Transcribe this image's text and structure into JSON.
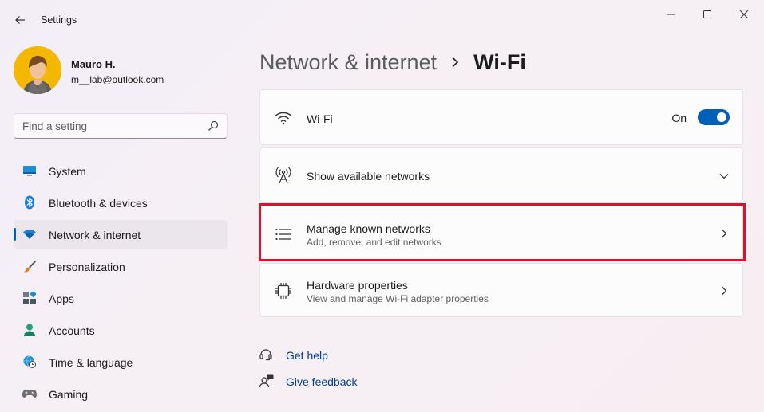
{
  "app": {
    "title": "Settings"
  },
  "user": {
    "name": "Mauro H.",
    "email": "m__lab@outlook.com"
  },
  "search": {
    "placeholder": "Find a setting",
    "value": ""
  },
  "sidebar": {
    "items": [
      {
        "label": "System",
        "icon": "system-icon"
      },
      {
        "label": "Bluetooth & devices",
        "icon": "bluetooth-icon"
      },
      {
        "label": "Network & internet",
        "icon": "wifi-icon",
        "active": true
      },
      {
        "label": "Personalization",
        "icon": "brush-icon"
      },
      {
        "label": "Apps",
        "icon": "apps-icon"
      },
      {
        "label": "Accounts",
        "icon": "person-icon"
      },
      {
        "label": "Time & language",
        "icon": "globe-clock-icon"
      },
      {
        "label": "Gaming",
        "icon": "gamepad-icon"
      }
    ]
  },
  "breadcrumb": {
    "parent": "Network & internet",
    "separator": "›",
    "current": "Wi-Fi"
  },
  "cards": {
    "wifi": {
      "title": "Wi-Fi",
      "toggle_label": "On",
      "toggle_on": true
    },
    "show_networks": {
      "title": "Show available networks"
    },
    "manage": {
      "title": "Manage known networks",
      "subtitle": "Add, remove, and edit networks",
      "highlighted": true
    },
    "hardware": {
      "title": "Hardware properties",
      "subtitle": "View and manage Wi-Fi adapter properties"
    }
  },
  "links": {
    "help": "Get help",
    "feedback": "Give feedback"
  },
  "colors": {
    "accent": "#005fb8",
    "highlight": "#d9132b",
    "link": "#003e92"
  }
}
